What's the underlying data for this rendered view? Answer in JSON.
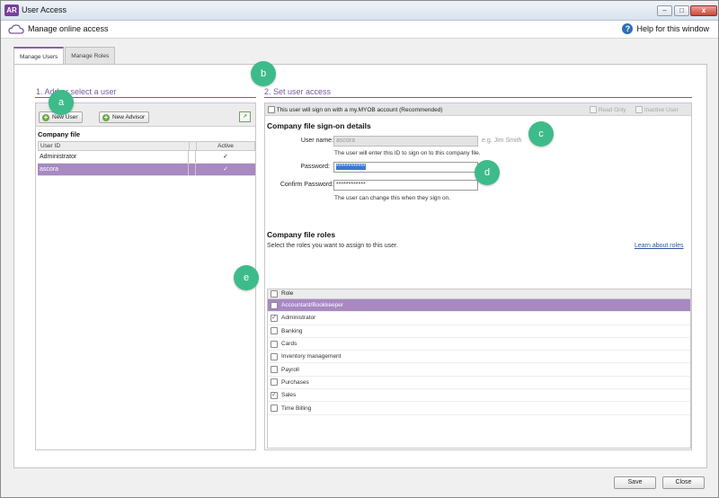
{
  "window": {
    "app_icon_text": "AR",
    "title": "User Access",
    "minimize": "–",
    "maximize": "□",
    "close": "x"
  },
  "header": {
    "title": "Manage online access",
    "help_icon": "?",
    "help_label": "Help for this window"
  },
  "tabs": [
    {
      "label": "Manage Users"
    },
    {
      "label": "Manage Roles"
    }
  ],
  "left": {
    "section_title": "1. Add or select a user",
    "new_user": "New User",
    "new_advisor": "New Advisor",
    "export_icon": "↗",
    "company_file": "Company file",
    "col_user": "User ID",
    "col_active": "Active",
    "users": [
      {
        "id": "Administrator",
        "active": "✓"
      },
      {
        "id": "ascora",
        "active": "✓"
      }
    ]
  },
  "right": {
    "section_title": "2. Set user access",
    "myob_label": "This user will sign on with a my.MYOB account (Recommended)",
    "read_only": "Read Only",
    "inactive_user": "Inactive User",
    "signon_heading": "Company file sign-on details",
    "username_label": "User name:",
    "username_value": "ascora",
    "username_hint": "e.g. Jim Smith",
    "username_note": "The user will enter this ID to sign on to this company file.",
    "password_label": "Password:",
    "password_value": "************",
    "confirm_label": "Confirm Password:",
    "confirm_value": "************",
    "password_note": "The user can change this when they sign on.",
    "roles_heading": "Company file roles",
    "roles_instruction": "Select the roles you want to assign to this user.",
    "learn_link": "Learn about roles",
    "roles_col": "Role",
    "roles": [
      {
        "name": "Accountant/Bookkeeper",
        "checked": false
      },
      {
        "name": "Administrator",
        "checked": true
      },
      {
        "name": "Banking",
        "checked": false
      },
      {
        "name": "Cards",
        "checked": false
      },
      {
        "name": "Inventory management",
        "checked": false
      },
      {
        "name": "Payroll",
        "checked": false
      },
      {
        "name": "Purchases",
        "checked": false
      },
      {
        "name": "Sales",
        "checked": true
      },
      {
        "name": "Time Billing",
        "checked": false
      }
    ]
  },
  "callouts": [
    "a",
    "b",
    "c",
    "d",
    "e"
  ],
  "footer": {
    "save": "Save",
    "close": "Close"
  },
  "colors": {
    "accent": "#7b57a3",
    "selection": "#a889c2",
    "callout": "#3ebb8a"
  }
}
